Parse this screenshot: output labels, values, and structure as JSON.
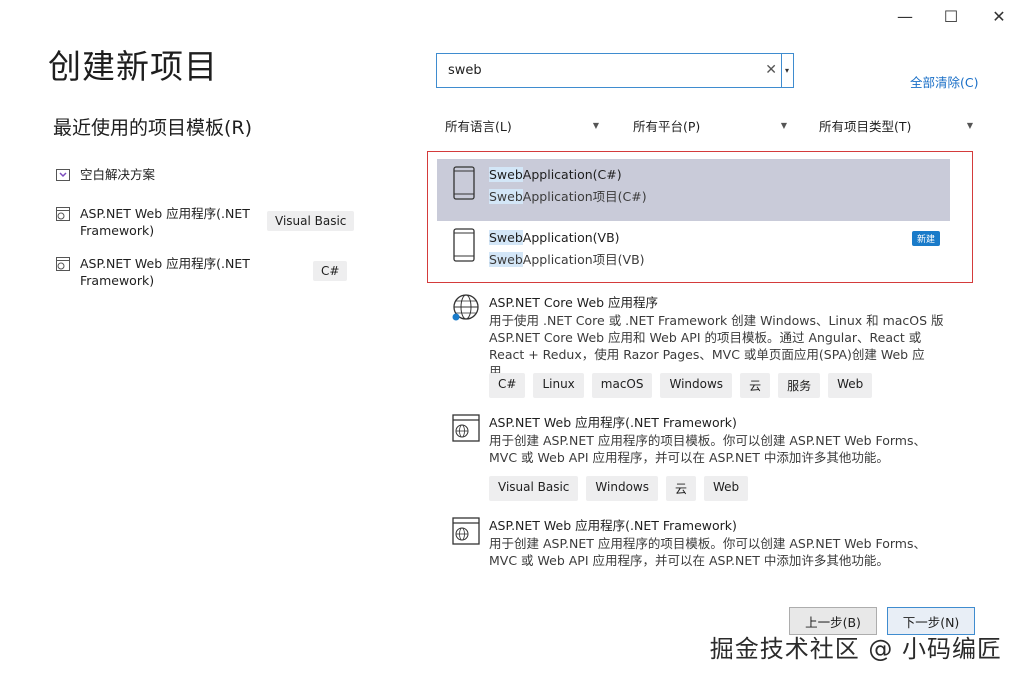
{
  "window": {
    "minimize_glyph": "—",
    "maximize_glyph": "☐",
    "close_glyph": "✕"
  },
  "page_title": "创建新项目",
  "recent": {
    "title": "最近使用的项目模板(R)",
    "items": [
      {
        "label": "空白解决方案",
        "icon": "blank-solution-icon",
        "tag": ""
      },
      {
        "label": "ASP.NET Web 应用程序(.NET Framework)",
        "icon": "web-app-icon",
        "tag": "Visual Basic"
      },
      {
        "label": "ASP.NET Web 应用程序(.NET Framework)",
        "icon": "web-app-icon",
        "tag": "C#"
      }
    ]
  },
  "search": {
    "value": "sweb",
    "clear_glyph": "✕",
    "dropdown_glyph": "▾"
  },
  "clear_all": "全部清除(C)",
  "filters": [
    {
      "label": "所有语言(L)"
    },
    {
      "label": "所有平台(P)"
    },
    {
      "label": "所有项目类型(T)"
    }
  ],
  "templates": [
    {
      "name_hl": "Sweb",
      "name_rest": "Application(C#)",
      "desc_hl": "Sweb",
      "desc_rest": "Application项目(C#)",
      "icon": "mobile-device-icon",
      "selected": true,
      "badge": ""
    },
    {
      "name_hl": "Sweb",
      "name_rest": "Application(VB)",
      "desc_hl": "Sweb",
      "desc_rest": "Application项目(VB)",
      "icon": "mobile-device-icon",
      "selected": false,
      "badge": "新建"
    },
    {
      "name": "ASP.NET Core Web 应用程序",
      "desc": "用于使用 .NET Core 或 .NET Framework 创建 Windows、Linux 和 macOS 版 ASP.NET Core Web 应用和 Web API 的项目模板。通过 Angular、React 或 React + Redux，使用 Razor Pages、MVC 或单页面应用(SPA)创建 Web 应用。",
      "icon": "globe-icon",
      "tags": [
        "C#",
        "Linux",
        "macOS",
        "Windows",
        "云",
        "服务",
        "Web"
      ]
    },
    {
      "name": "ASP.NET Web 应用程序(.NET Framework)",
      "desc": "用于创建 ASP.NET 应用程序的项目模板。你可以创建 ASP.NET Web Forms、MVC 或 Web API 应用程序，并可以在 ASP.NET 中添加许多其他功能。",
      "icon": "web-app-icon",
      "tags": [
        "Visual Basic",
        "Windows",
        "云",
        "Web"
      ]
    },
    {
      "name": "ASP.NET Web 应用程序(.NET Framework)",
      "desc": "用于创建 ASP.NET 应用程序的项目模板。你可以创建 ASP.NET Web Forms、MVC 或 Web API 应用程序，并可以在 ASP.NET 中添加许多其他功能。",
      "icon": "web-app-icon"
    }
  ],
  "buttons": {
    "back": "上一步(B)",
    "next": "下一步(N)"
  },
  "watermark": "掘金技术社区 @ 小码编匠",
  "colors": {
    "selected_bg": "#c9cbd9",
    "highlight_frame": "#d43b3b",
    "accent": "#1a7bc9",
    "link": "#1a6fc7"
  }
}
